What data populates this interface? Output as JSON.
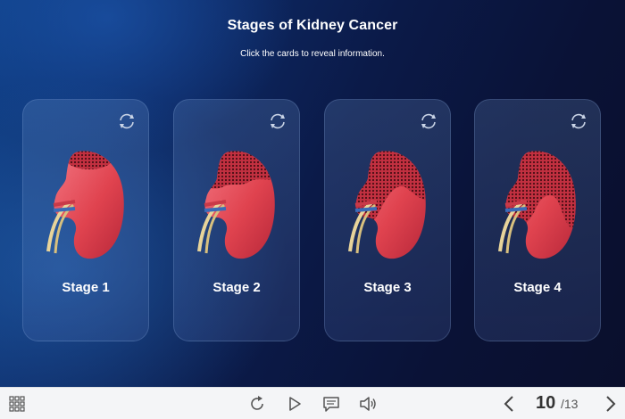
{
  "title": "Stages of Kidney Cancer",
  "subtitle": "Click the cards to reveal information.",
  "cards": [
    {
      "label": "Stage 1"
    },
    {
      "label": "Stage 2"
    },
    {
      "label": "Stage 3"
    },
    {
      "label": "Stage 4"
    }
  ],
  "player": {
    "current_page": "10",
    "total_pages": "/13"
  },
  "icons": {
    "flip": "flip-icon",
    "menu": "grid-menu-icon",
    "replay": "replay-icon",
    "play": "play-icon",
    "notes": "notes-icon",
    "audio": "audio-icon",
    "prev": "chevron-left-icon",
    "next": "chevron-right-icon"
  },
  "colors": {
    "kidney": "#e24b59",
    "tumor_dots": "#5a1218",
    "card_text": "#ffffff"
  }
}
